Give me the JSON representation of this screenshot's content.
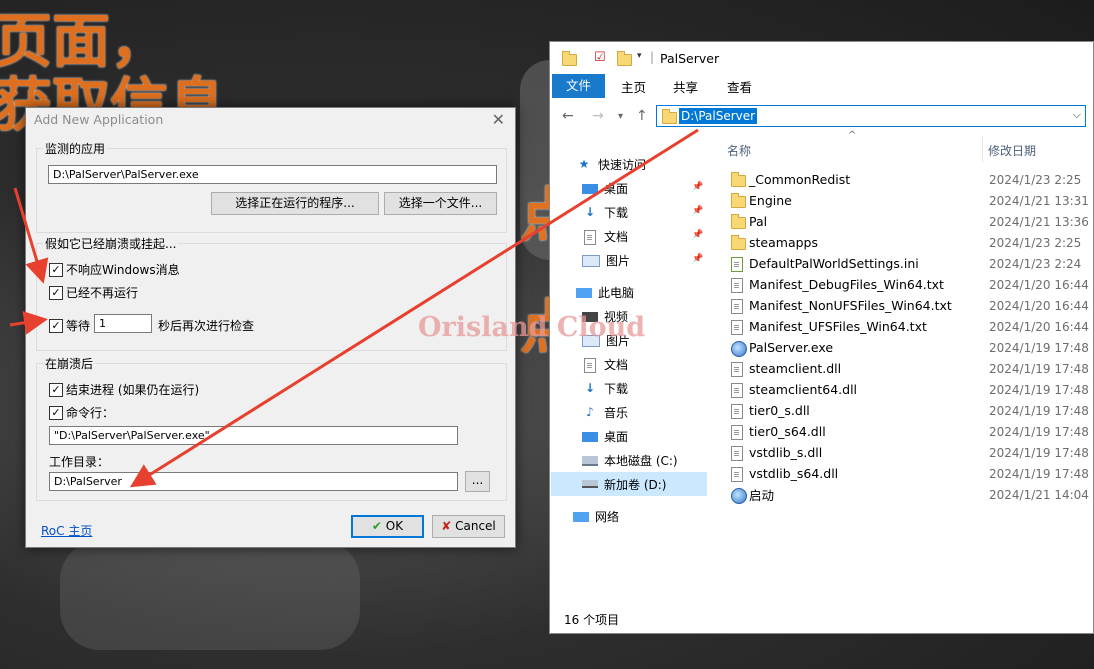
{
  "background": {
    "lines": [
      "页面，",
      "获取信息",
      "点",
      "点"
    ]
  },
  "dialog": {
    "title": "Add New Application",
    "monitor_group": "监测的应用",
    "app_path": "D:\\PalServer\\PalServer.exe",
    "select_running_button": "选择正在运行的程序...",
    "select_file_button": "选择一个文件...",
    "crash_group": "假如它已经崩溃或挂起...",
    "cb_not_responding": "不响应Windows消息",
    "cb_not_running": "已经不再运行",
    "cb_wait_prefix": "等待",
    "wait_seconds": "1",
    "wait_suffix": "秒后再次进行检查",
    "after_group": "在崩溃后",
    "cb_kill": "结束进程 (如果仍在运行)",
    "cb_command": "命令行：",
    "command_line": "\"D:\\PalServer\\PalServer.exe\"",
    "workdir_label": "工作目录：",
    "workdir": "D:\\PalServer",
    "browse_button": "...",
    "home_link": "RoC 主页",
    "ok_button": "OK",
    "cancel_button": "Cancel"
  },
  "explorer": {
    "title": "PalServer",
    "tabs": [
      "文件",
      "主页",
      "共享",
      "查看"
    ],
    "address": "D:\\PalServer",
    "columns": {
      "name": "名称",
      "date": "修改日期"
    },
    "nav": [
      {
        "label": "快速访问",
        "icon": "star-icon",
        "pinned": false
      },
      {
        "label": "桌面",
        "icon": "desktop-icon",
        "pinned": true
      },
      {
        "label": "下载",
        "icon": "download-icon",
        "pinned": true
      },
      {
        "label": "文档",
        "icon": "document-icon",
        "pinned": true
      },
      {
        "label": "图片",
        "icon": "picture-icon",
        "pinned": true
      },
      {
        "label": "此电脑",
        "icon": "computer-icon",
        "pinned": false
      },
      {
        "label": "视频",
        "icon": "video-icon",
        "pinned": false
      },
      {
        "label": "图片",
        "icon": "picture-icon",
        "pinned": false
      },
      {
        "label": "文档",
        "icon": "document-icon",
        "pinned": false
      },
      {
        "label": "下载",
        "icon": "download-icon",
        "pinned": false
      },
      {
        "label": "音乐",
        "icon": "music-icon",
        "pinned": false
      },
      {
        "label": "桌面",
        "icon": "desktop-icon",
        "pinned": false
      },
      {
        "label": "本地磁盘 (C:)",
        "icon": "drive-icon",
        "pinned": false
      },
      {
        "label": "新加卷 (D:)",
        "icon": "drive-icon",
        "pinned": false
      },
      {
        "label": "网络",
        "icon": "network-icon",
        "pinned": false
      }
    ],
    "files": [
      {
        "name": "_CommonRedist",
        "date": "2024/1/23 2:25",
        "type": "folder"
      },
      {
        "name": "Engine",
        "date": "2024/1/21 13:31",
        "type": "folder"
      },
      {
        "name": "Pal",
        "date": "2024/1/21 13:36",
        "type": "folder"
      },
      {
        "name": "steamapps",
        "date": "2024/1/23 2:25",
        "type": "folder"
      },
      {
        "name": "DefaultPalWorldSettings.ini",
        "date": "2024/1/23 2:24",
        "type": "ini"
      },
      {
        "name": "Manifest_DebugFiles_Win64.txt",
        "date": "2024/1/20 16:44",
        "type": "doc"
      },
      {
        "name": "Manifest_NonUFSFiles_Win64.txt",
        "date": "2024/1/20 16:44",
        "type": "doc"
      },
      {
        "name": "Manifest_UFSFiles_Win64.txt",
        "date": "2024/1/20 16:44",
        "type": "doc"
      },
      {
        "name": "PalServer.exe",
        "date": "2024/1/19 17:48",
        "type": "exe"
      },
      {
        "name": "steamclient.dll",
        "date": "2024/1/19 17:48",
        "type": "doc"
      },
      {
        "name": "steamclient64.dll",
        "date": "2024/1/19 17:48",
        "type": "doc"
      },
      {
        "name": "tier0_s.dll",
        "date": "2024/1/19 17:48",
        "type": "doc"
      },
      {
        "name": "tier0_s64.dll",
        "date": "2024/1/19 17:48",
        "type": "doc"
      },
      {
        "name": "vstdlib_s.dll",
        "date": "2024/1/19 17:48",
        "type": "doc"
      },
      {
        "name": "vstdlib_s64.dll",
        "date": "2024/1/19 17:48",
        "type": "doc"
      },
      {
        "name": "启动",
        "date": "2024/1/21 14:04",
        "type": "exe"
      }
    ],
    "status": "16 个项目"
  },
  "watermark": "Orisland Cloud",
  "colors": {
    "accent": "#0078d7",
    "arrow": "#e8402f",
    "overlay_text": "#e8731e"
  }
}
